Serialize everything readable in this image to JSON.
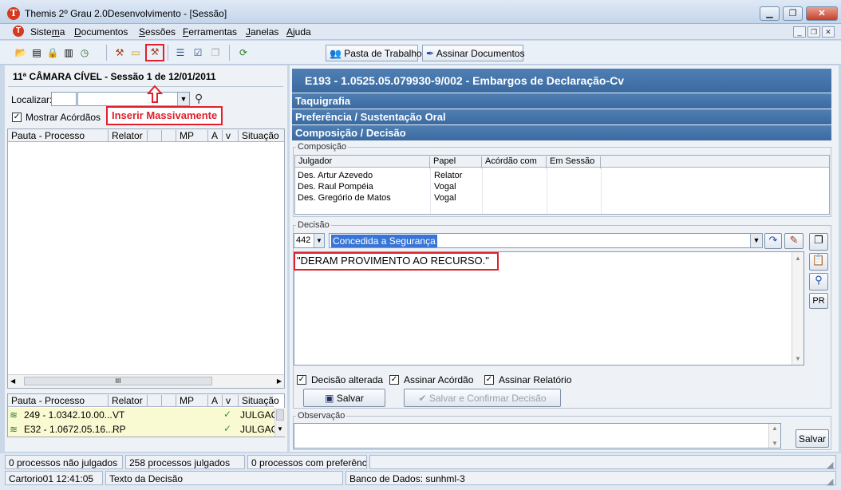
{
  "window": {
    "title": "Themis 2º Grau 2.0Desenvolvimento - [Sessão]",
    "app_icon": "T"
  },
  "menu": {
    "items": [
      "Sistema",
      "Documentos",
      "Sessões",
      "Ferramentas",
      "Janelas",
      "Ajuda"
    ],
    "underline": [
      "m",
      "D",
      "S",
      "F",
      "J",
      "A"
    ]
  },
  "toolbar": {
    "pasta_label": "Pasta de Trabalho",
    "assinar_label": "Assinar Documentos"
  },
  "left": {
    "session_title": "11ª  CÂMARA CÍVEL - Sessão 1 de 12/01/2011",
    "localizar_label": "Localizar:",
    "mostrar_acordaos": "Mostrar Acórdãos",
    "annotation": "Inserir Massivamente",
    "grid1_headers": [
      "Pauta - Processo",
      "Relator",
      "",
      "",
      "MP",
      "A",
      "v",
      "Situação"
    ],
    "grid2_headers": [
      "Pauta - Processo",
      "Relator",
      "",
      "",
      "MP",
      "A",
      "v",
      "Situação"
    ],
    "grid2_rows": [
      {
        "pauta": "249 - 1.0342.10.00...",
        "relator": "VT",
        "situacao": "JULGAC"
      },
      {
        "pauta": "E32 - 1.0672.05.16...",
        "relator": "RP",
        "situacao": "JULGAC"
      }
    ],
    "scroll_mark": "III"
  },
  "right": {
    "header": "E193   -   1.0525.05.079930-9/002 - Embargos de Declaração-Cv",
    "section_taquigrafia": "Taquigrafia",
    "section_preferencia": "Preferência / Sustentação Oral",
    "section_composicao": "Composição / Decisão",
    "composicao_label": "Composição",
    "composicao_headers": [
      "Julgador",
      "Papel",
      "Acórdão com",
      "Em Sessão"
    ],
    "composicao_rows": [
      {
        "julgador": "Des. Artur Azevedo",
        "papel": "Relator"
      },
      {
        "julgador": "Des. Raul Pompéia",
        "papel": "Vogal"
      },
      {
        "julgador": "Des. Gregório de Matos",
        "papel": "Vogal"
      }
    ],
    "decisao_label": "Decisão",
    "decisao_code": "442",
    "decisao_value": "Concedida a Segurança",
    "decisao_text": "\"DERAM PROVIMENTO AO RECURSO.\"",
    "chk_decisao_alterada": "Decisão alterada",
    "chk_assinar_acordao": "Assinar Acórdão",
    "chk_assinar_relatorio": "Assinar Relatório",
    "salvar_label": "Salvar",
    "salvar_confirmar_label": "Salvar e Confirmar Decisão",
    "pr_label": "PR",
    "observacao_label": "Observação",
    "obs_salvar_label": "Salvar"
  },
  "status": {
    "nao_julgados": "0 processos não julgados",
    "julgados": "258 processos julgados",
    "preferencia": "0 processos com preferênci",
    "user_time": "Cartorio01  12:41:05",
    "context": "Texto da Decisão",
    "banco": "Banco de Dados: sunhml-3"
  },
  "colors": {
    "accent_blue": "#3a6aa0",
    "highlight": "#3875d7",
    "annotation_red": "#e0202a",
    "row_yellow": "#fafad2"
  }
}
